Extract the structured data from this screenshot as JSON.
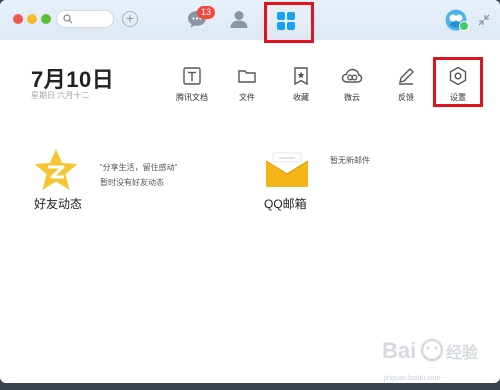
{
  "titlebar": {
    "message_badge": "13",
    "icons": [
      "search-icon",
      "add-icon",
      "message-icon",
      "contacts-icon",
      "apps-icon",
      "avatar-icon",
      "collapse-icon"
    ]
  },
  "date": {
    "main": "7月10日",
    "sub": "星期日  六月十二"
  },
  "tools": [
    {
      "label": "腾讯文档",
      "icon": "tencent-docs-icon"
    },
    {
      "label": "文件",
      "icon": "folder-icon"
    },
    {
      "label": "收藏",
      "icon": "favorites-icon"
    },
    {
      "label": "微云",
      "icon": "weiyun-icon"
    },
    {
      "label": "反馈",
      "icon": "feedback-icon"
    },
    {
      "label": "设置",
      "icon": "settings-icon"
    }
  ],
  "cards": {
    "qzone": {
      "title": "好友动态",
      "quote": "“分享生活，留住感动”",
      "status": "暂时没有好友动态"
    },
    "mail": {
      "title": "QQ邮箱",
      "status": "暂无新邮件"
    }
  },
  "watermark": {
    "url": "jingyan.baidu.com"
  },
  "colors": {
    "highlight": "#e0141e",
    "badge": "#f04a3e",
    "apps_blue": "#1aa0f0",
    "qzone_yellow": "#f7c531",
    "mail_yellow": "#f5b517"
  }
}
